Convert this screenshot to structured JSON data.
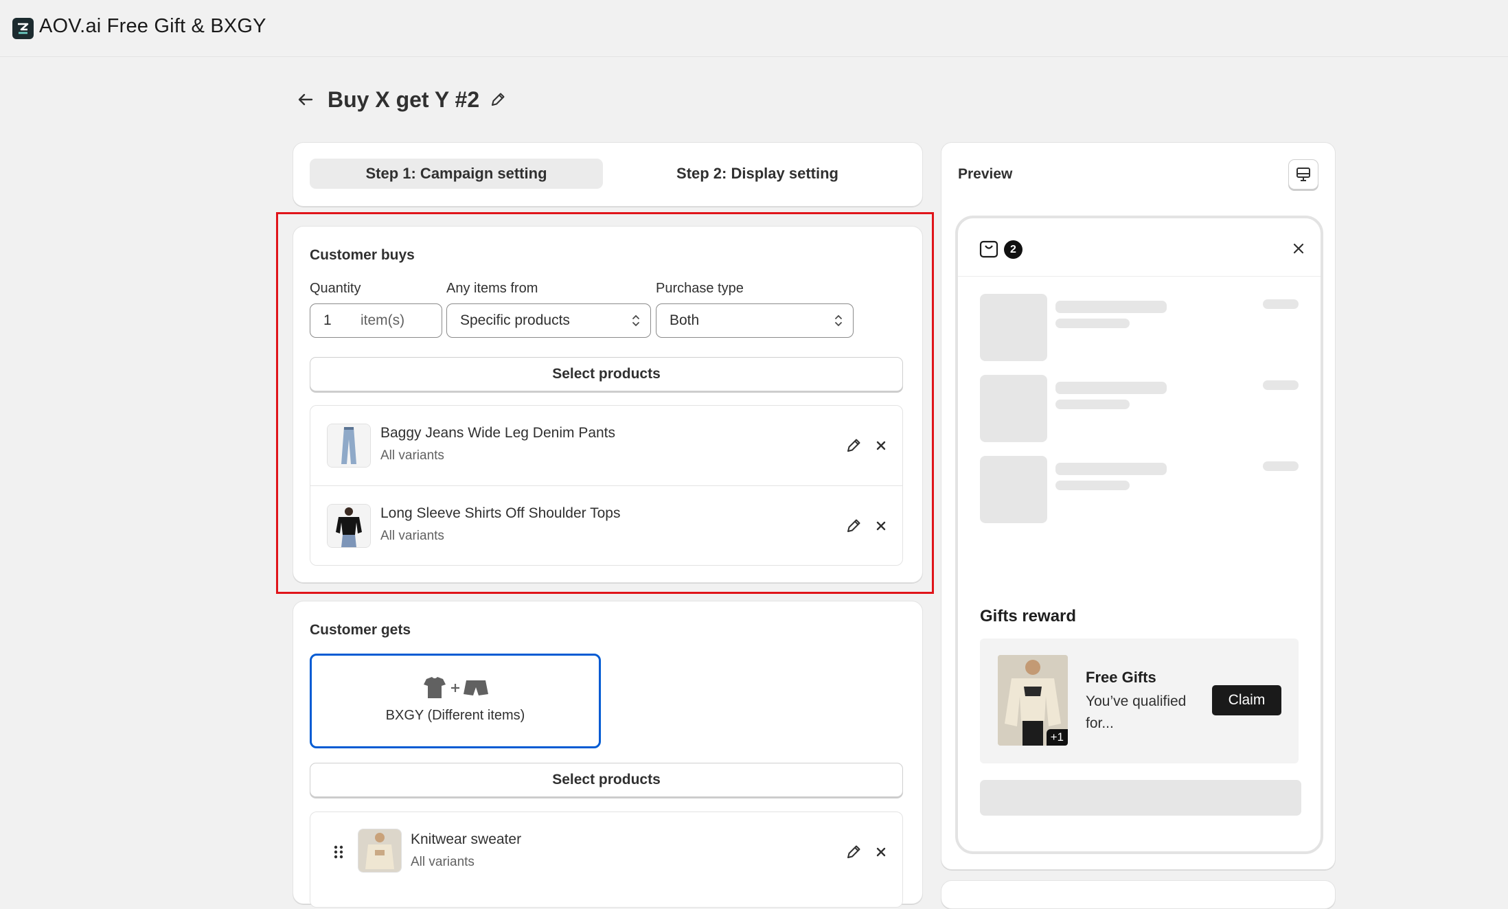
{
  "app": {
    "name": "AOV.ai Free Gift & BXGY"
  },
  "page": {
    "title": "Buy X get Y #2"
  },
  "steps": [
    {
      "label": "Step 1: Campaign setting"
    },
    {
      "label": "Step 2: Display setting"
    }
  ],
  "customer_buys": {
    "title": "Customer buys",
    "quantity_label": "Quantity",
    "quantity_value": "1",
    "quantity_unit": "item(s)",
    "items_from_label": "Any items from",
    "items_from_value": "Specific products",
    "purchase_type_label": "Purchase type",
    "purchase_type_value": "Both",
    "select_button": "Select products",
    "products": [
      {
        "name": "Baggy Jeans Wide Leg Denim Pants",
        "variants": "All variants"
      },
      {
        "name": "Long Sleeve Shirts Off Shoulder Tops",
        "variants": "All variants"
      }
    ]
  },
  "customer_gets": {
    "title": "Customer gets",
    "type_option": "BXGY (Different items)",
    "select_button": "Select products",
    "products": [
      {
        "name": "Knitwear sweater",
        "variants": "All variants"
      }
    ]
  },
  "preview": {
    "title": "Preview",
    "cart_count": "2",
    "gifts_title": "Gifts reward",
    "gift_name": "Free Gifts",
    "gift_desc": "You’ve qualified for...",
    "gift_extra": "+1",
    "claim_label": "Claim"
  },
  "colors": {
    "accent_border": "#005bd3",
    "highlight_border": "#e0141a",
    "background": "#f1f1f1"
  },
  "icons": [
    "back-arrow-icon",
    "pencil-icon",
    "close-icon",
    "chevron-updown-icon",
    "desktop-icon",
    "bag-icon",
    "drag-handle-icon",
    "tshirt-icon",
    "shorts-icon"
  ]
}
